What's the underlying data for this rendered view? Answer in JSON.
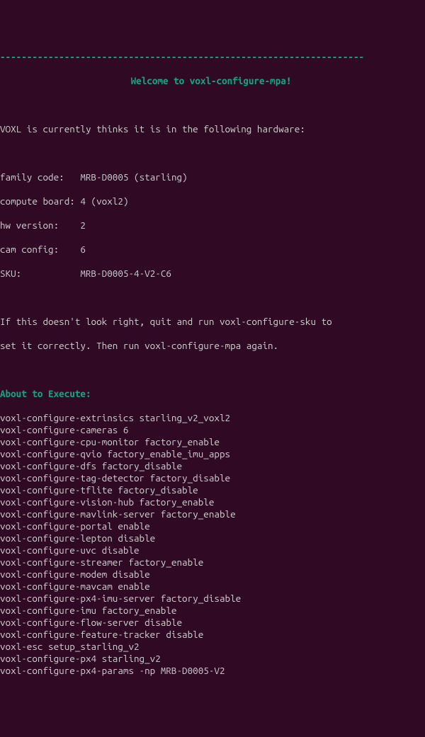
{
  "dashes": "--------------------------------------------------------------------",
  "title": "Welcome to voxl-configure-mpa!",
  "intro": "VOXL is currently thinks it is in the following hardware:",
  "hw": {
    "family_code_label": "family code:",
    "family_code_value": "MRB-D0005 (starling)",
    "compute_board_label": "compute board:",
    "compute_board_value": "4 (voxl2)",
    "hw_version_label": "hw version:",
    "hw_version_value": "2",
    "cam_config_label": "cam config:",
    "cam_config_value": "6",
    "sku_label": "SKU:",
    "sku_value": "MRB-D0005-4-V2-C6"
  },
  "warn1": "If this doesn't look right, quit and run voxl-configure-sku to",
  "warn2": "set it correctly. Then run voxl-configure-mpa again.",
  "about": "About to Execute:",
  "cmds": [
    "voxl-configure-extrinsics starling_v2_voxl2",
    "voxl-configure-cameras 6",
    "voxl-configure-cpu-monitor factory_enable",
    "voxl-configure-qvio factory_enable_imu_apps",
    "voxl-configure-dfs factory_disable",
    "voxl-configure-tag-detector factory_disable",
    "voxl-configure-tflite factory_disable",
    "voxl-configure-vision-hub factory_enable",
    "voxl-configure-mavlink-server factory_enable",
    "voxl-configure-portal enable",
    "voxl-configure-lepton disable",
    "voxl-configure-uvc disable",
    "voxl-configure-streamer factory_enable",
    "voxl-configure-modem disable",
    "voxl-configure-mavcam enable",
    "voxl-configure-px4-imu-server factory_disable",
    "voxl-configure-imu factory_enable",
    "voxl-configure-flow-server disable",
    "voxl-configure-feature-tracker disable",
    "voxl-esc setup_starling_v2",
    "voxl-configure-px4 starling_v2",
    "voxl-configure-px4-params -np MRB-D0005-V2"
  ]
}
